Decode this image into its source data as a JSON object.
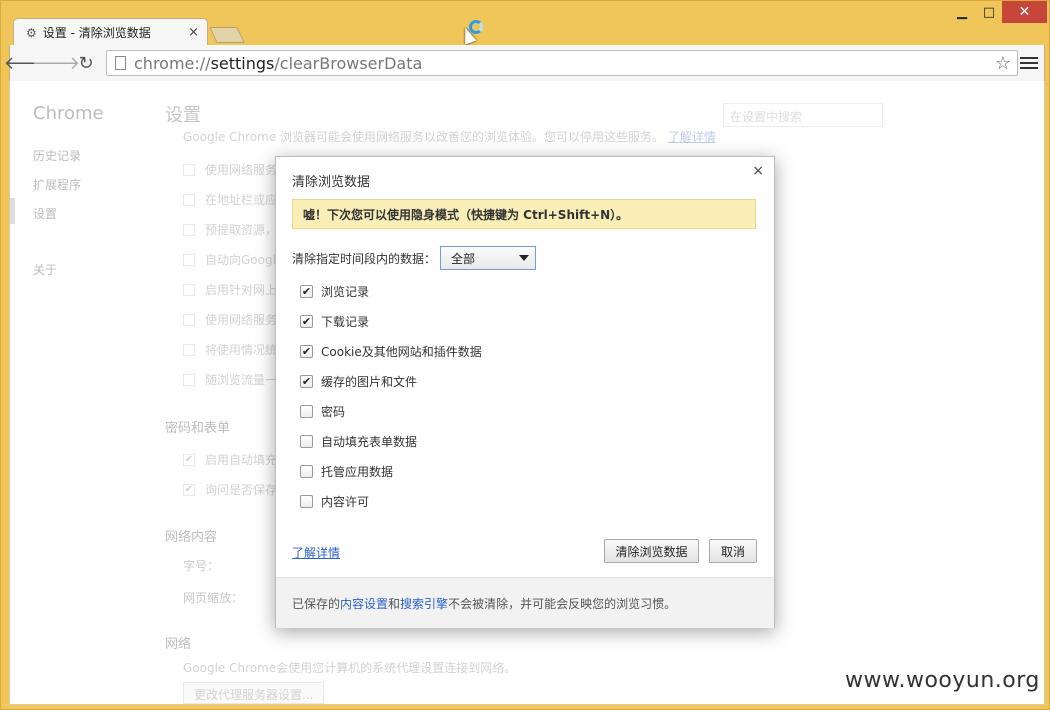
{
  "window": {
    "tab_title": "设置 - 清除浏览数据",
    "tab_close": "×",
    "minimize": "▁",
    "maximize": "□",
    "close": "✕"
  },
  "toolbar": {
    "url_scheme": "chrome://",
    "url_host": "settings",
    "url_path": "/clearBrowserData"
  },
  "sidebar": {
    "brand": "Chrome",
    "items": [
      "历史记录",
      "扩展程序",
      "设置",
      "关于"
    ],
    "active": "设置"
  },
  "settings": {
    "title": "设置",
    "search_placeholder": "在设置中搜索",
    "privacy_desc": "Google Chrome 浏览器可能会使用网络服务以改善您的浏览体验。您可以停用这些服务。",
    "privacy_desc_link": "了解详情",
    "privacy_options": [
      "使用网络服务",
      "在地址栏或应",
      "预提取资源，",
      "自动向Google",
      "启用针对网上",
      "使用网络服务",
      "将使用情况统",
      "随浏览流量一"
    ],
    "passwords_title": "密码和表单",
    "passwords_options": [
      "启用自动填充",
      "询问是否保存"
    ],
    "web_content_title": "网络内容",
    "font_size_label": "字号：",
    "zoom_label": "网页缩放：",
    "network_title": "网络",
    "network_desc": "Google Chrome会使用您计算机的系统代理设置连接到网络。",
    "proxy_button": "更改代理服务器设置..."
  },
  "dialog": {
    "title": "清除浏览数据",
    "close": "×",
    "banner": "嘘！下次您可以使用隐身模式（快捷键为 Ctrl+Shift+N）。",
    "range_label": "清除指定时间段内的数据：",
    "range_value": "全部",
    "options": [
      {
        "label": "浏览记录",
        "checked": true
      },
      {
        "label": "下载记录",
        "checked": true
      },
      {
        "label": "Cookie及其他网站和插件数据",
        "checked": true
      },
      {
        "label": "缓存的图片和文件",
        "checked": true
      },
      {
        "label": "密码",
        "checked": false
      },
      {
        "label": "自动填充表单数据",
        "checked": false
      },
      {
        "label": "托管应用数据",
        "checked": false
      },
      {
        "label": "内容许可",
        "checked": false
      }
    ],
    "learn_more": "了解详情",
    "clear_button": "清除浏览数据",
    "cancel_button": "取消",
    "footer_prefix": "已保存的",
    "footer_link1": "内容设置",
    "footer_and": "和",
    "footer_link2": "搜索引擎",
    "footer_suffix": "不会被清除，并可能会反映您的浏览习惯。"
  },
  "watermark": "www.wooyun.org"
}
